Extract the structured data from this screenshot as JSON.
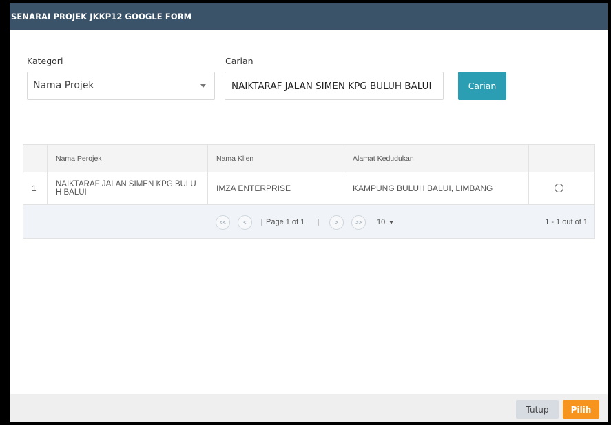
{
  "modal": {
    "title": "SENARAI PROJEK JKKP12 GOOGLE FORM"
  },
  "filters": {
    "category_label": "Kategori",
    "category_value": "Nama Projek",
    "search_label": "Carian",
    "search_value": "NAIKTARAF JALAN SIMEN KPG BULUH BALUI",
    "search_button": "Carian"
  },
  "table": {
    "columns": [
      "Nama Perojek",
      "Nama Klien",
      "Alamat Kedudukan"
    ],
    "rows": [
      {
        "no": "1",
        "project": "NAIKTARAF JALAN SIMEN KPG BULU H BALUI",
        "client": "IMZA ENTERPRISE",
        "address": "KAMPUNG BULUH BALUI, LIMBANG"
      }
    ]
  },
  "pager": {
    "first": "<<",
    "prev": "<",
    "page_text": "Page 1 of 1",
    "next": ">",
    "last": ">>",
    "page_size": "10",
    "summary": "1 - 1 out of 1"
  },
  "footer": {
    "close": "Tutup",
    "pick": "Pilih"
  },
  "colors": {
    "header": "#3b5369",
    "search_button": "#2b9eb3",
    "pick_button": "#f7941d"
  }
}
